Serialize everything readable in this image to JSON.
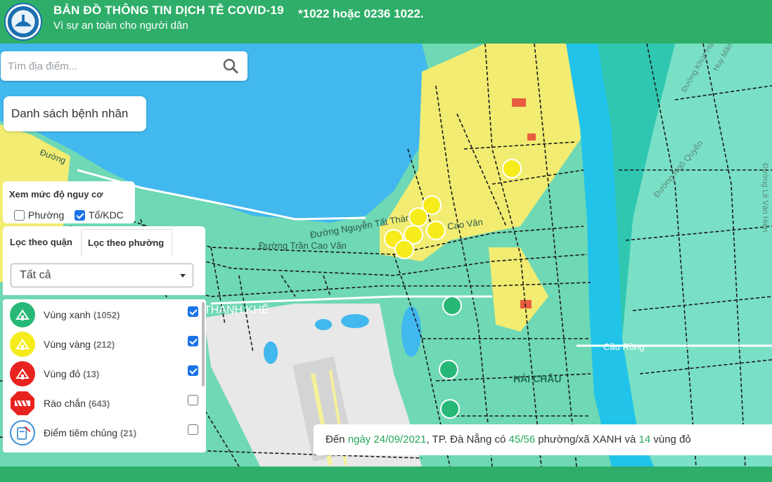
{
  "header": {
    "title": "BẢN ĐỒ THÔNG TIN DỊCH TỄ COVID-19",
    "subtitle": "Vì sự an toàn cho người dân",
    "hotline": "*1022 hoặc 0236 1022."
  },
  "search": {
    "placeholder": "Tìm địa điểm..."
  },
  "patients_button": "Danh sách bệnh nhân",
  "risk_filter": {
    "title": "Xem mức độ nguy cơ",
    "options": [
      {
        "label": "Phường",
        "checked": false
      },
      {
        "label": "Tổ/KDC",
        "checked": true
      }
    ]
  },
  "tabs": {
    "by_district": "Lọc theo quận",
    "by_ward": "Lọc theo phường"
  },
  "district_select": {
    "value": "Tất cả"
  },
  "legend": [
    {
      "label": "Vùng xanh",
      "count": "(1052)",
      "checked": true,
      "color": "#27b877",
      "icon": "house-icon"
    },
    {
      "label": "Vùng vàng",
      "count": "(212)",
      "checked": true,
      "color": "#f6ec1c",
      "icon": "house-icon"
    },
    {
      "label": "Vùng đỏ",
      "count": "(13)",
      "checked": true,
      "color": "#e8231f",
      "icon": "house-icon"
    },
    {
      "label": "Rào chắn",
      "count": "(643)",
      "checked": false,
      "color": "#e8231f",
      "icon": "barrier-icon"
    },
    {
      "label": "Điểm tiêm chủng",
      "count": "(21)",
      "checked": false,
      "color": "#3e8ed8",
      "icon": "vaccine-icon"
    }
  ],
  "map": {
    "street_labels": [
      "Đường Nguyễn Tất Thành",
      "Đường Trần Cao Vân",
      "Cao Vân",
      "Đường Ngô Quyền",
      "Đường Lê Văn Hiến",
      "Cầu Rồng",
      "HẢI CHÂU",
      "THANH KHÊ",
      "Đường",
      "Huy Mân",
      "Đường Khúc Hạo"
    ],
    "colors": {
      "sea": "#41b8ee",
      "green_zone": "#6fd8b5",
      "yellow_zone": "#f2ec72",
      "red_zone": "#e85c3f",
      "river": "#22c3e8"
    }
  },
  "status": {
    "prefix": "Đến",
    "date": "ngày 24/09/2021",
    "middle": ", TP. Đà Nẵng có",
    "green_wards": "45/56",
    "wards_text": "phường/xã XANH và",
    "red_count": "14",
    "suffix": "vùng đỏ"
  }
}
